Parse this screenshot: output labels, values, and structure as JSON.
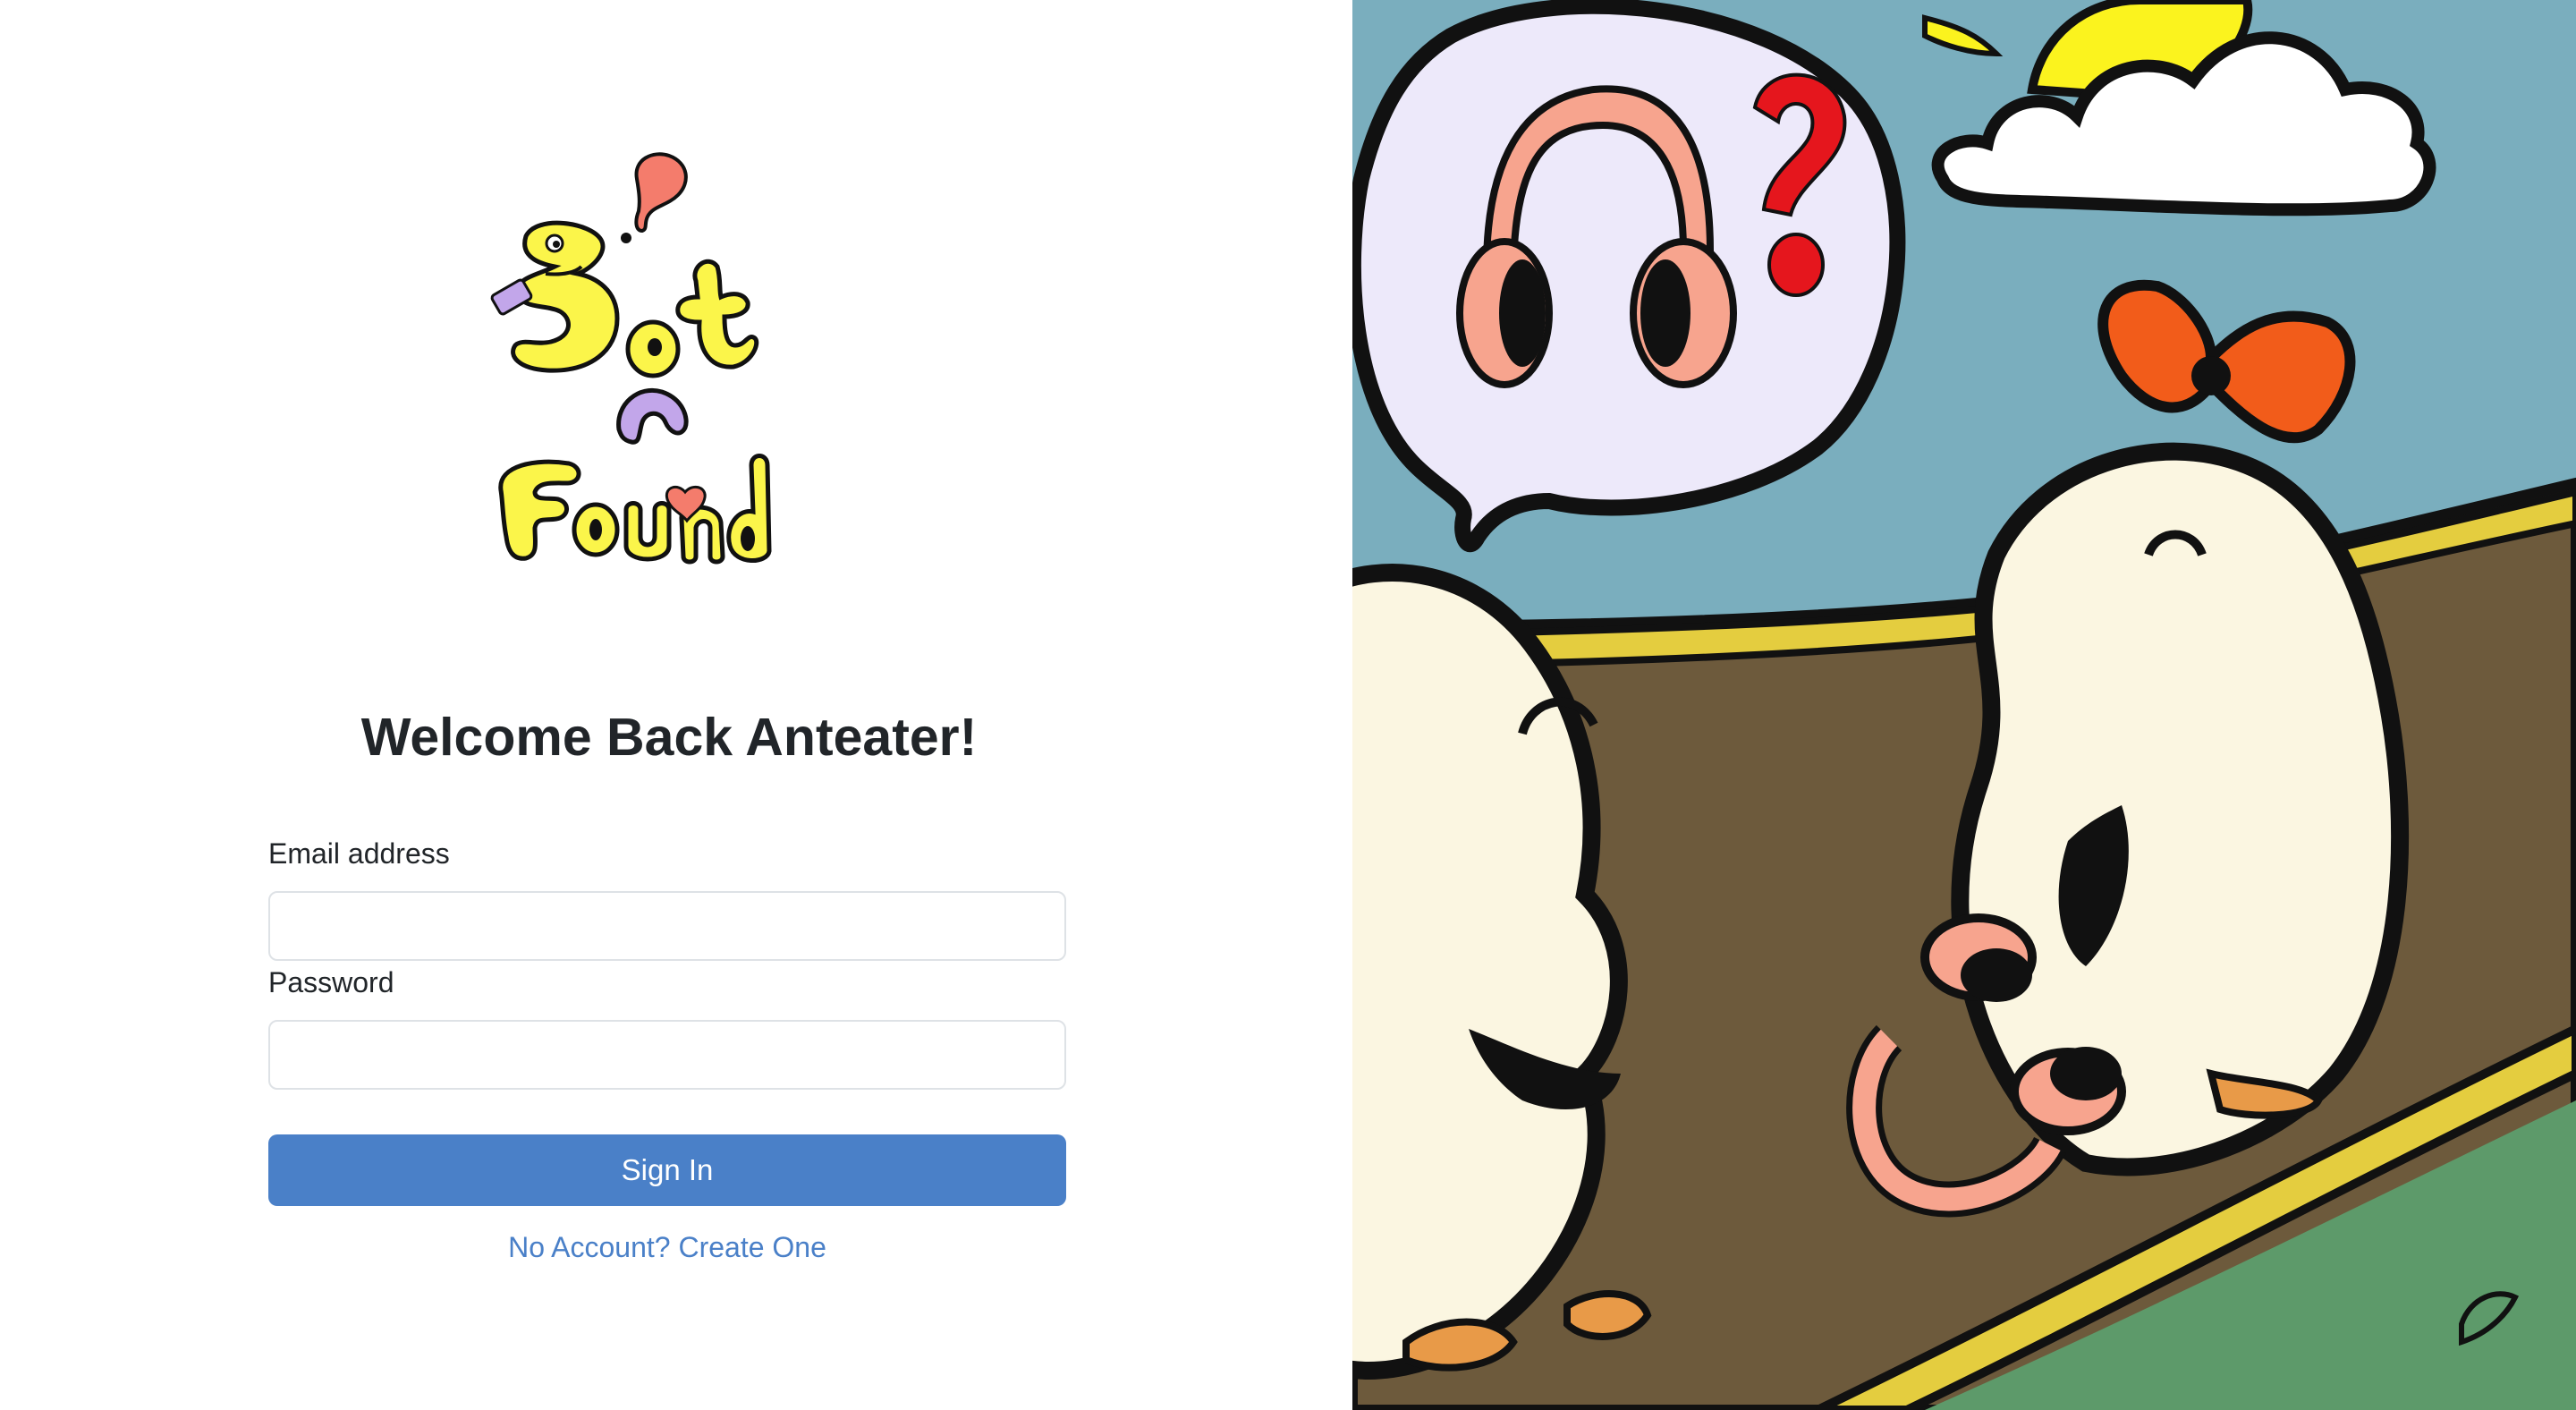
{
  "logo": {
    "name": "Lost n Found logo",
    "colors": {
      "letters": "#fbf54a",
      "bubble": "#f47c6c",
      "accent": "#c2a6ea",
      "heart": "#f47c6c"
    }
  },
  "login": {
    "title": "Welcome Back Anteater!",
    "email_label": "Email address",
    "email_value": "",
    "password_label": "Password",
    "password_value": "",
    "signin_label": "Sign In",
    "create_account_link": "No Account? Create One"
  },
  "colors": {
    "accent": "#4a80c8",
    "text": "#212529",
    "input_border": "#dee2e6"
  },
  "illustration": {
    "description_icons": [
      "headphones-icon",
      "question-mark-icon",
      "sun-icon",
      "cloud-icon"
    ],
    "colors": {
      "sky": "#7aaebe",
      "ground": "#6d5a3c",
      "path_edge": "#e4cd3f",
      "grass": "#5d9a6a",
      "character": "#fbf6e1",
      "headphones": "#f7a48e",
      "bow": "#f25c1a",
      "question_mark": "#e5161d",
      "sun": "#fbf31e"
    }
  }
}
